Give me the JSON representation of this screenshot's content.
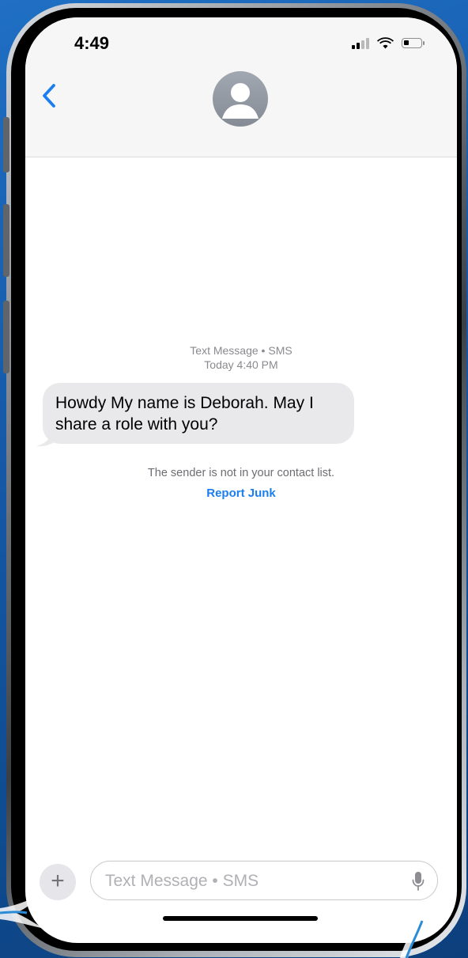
{
  "status_bar": {
    "time": "4:49",
    "icons": [
      "cellular-signal-icon",
      "wifi-icon",
      "battery-icon"
    ]
  },
  "header": {
    "back_icon": "chevron-left-icon",
    "contact_avatar_icon": "person-silhouette-icon"
  },
  "conversation": {
    "meta_type": "Text Message • SMS",
    "meta_time": "Today 4:40 PM",
    "messages": [
      {
        "direction": "incoming",
        "text": "Howdy My name is Deborah. May I share a role with you?"
      }
    ],
    "notice": "The sender is not in your contact list.",
    "report_link": "Report Junk"
  },
  "composer": {
    "add_icon": "plus-icon",
    "placeholder": "Text Message • SMS",
    "mic_icon": "microphone-icon"
  },
  "colors": {
    "accent_blue": "#1a7ef0",
    "incoming_bubble": "#e9e9eb",
    "header_bg": "#f6f6f6",
    "wallpaper": "#1559a8"
  }
}
